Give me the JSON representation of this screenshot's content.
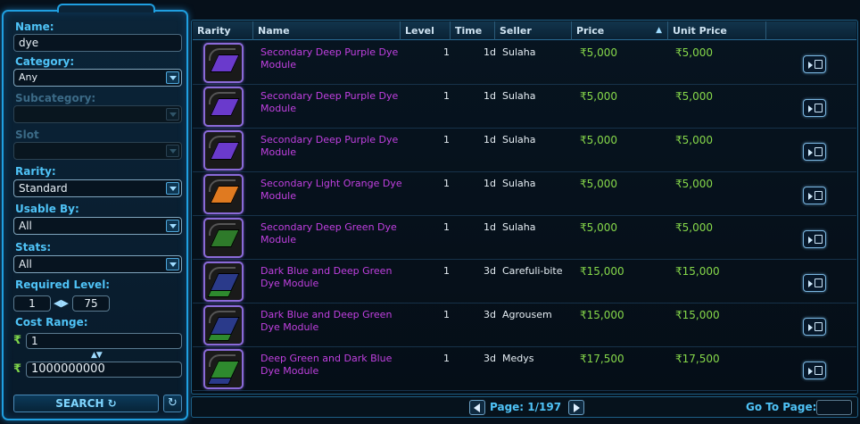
{
  "filters": {
    "name_label": "Name:",
    "name_value": "dye",
    "category_label": "Category:",
    "category_value": "Any",
    "subcategory_label": "Subcategory:",
    "subcategory_value": "",
    "slot_label": "Slot",
    "slot_value": "",
    "rarity_label": "Rarity:",
    "rarity_value": "Standard",
    "usable_label": "Usable By:",
    "usable_value": "All",
    "stats_label": "Stats:",
    "stats_value": "All",
    "level_label": "Required Level:",
    "level_min": "1",
    "level_max": "75",
    "cost_label": "Cost Range:",
    "cost_min": "1",
    "cost_max": "1000000000",
    "credit_symbol": "₹",
    "search_label": "SEARCH ↻",
    "reset_icon": "↻"
  },
  "table": {
    "headers": {
      "rarity": "Rarity",
      "name": "Name",
      "level": "Level",
      "time": "Time",
      "seller": "Seller",
      "price": "Price",
      "unit_price": "Unit Price"
    },
    "sort_indicator": "▲",
    "rows": [
      {
        "name": "Secondary Deep Purple Dye Module",
        "level": "1",
        "time": "1d",
        "seller": "Sulaha",
        "price": "₹5,000",
        "unit": "₹5,000",
        "colors": [
          "#6a3acc"
        ]
      },
      {
        "name": "Secondary Deep Purple Dye Module",
        "level": "1",
        "time": "1d",
        "seller": "Sulaha",
        "price": "₹5,000",
        "unit": "₹5,000",
        "colors": [
          "#6a3acc"
        ]
      },
      {
        "name": "Secondary Deep Purple Dye Module",
        "level": "1",
        "time": "1d",
        "seller": "Sulaha",
        "price": "₹5,000",
        "unit": "₹5,000",
        "colors": [
          "#6a3acc"
        ]
      },
      {
        "name": "Secondary Light Orange Dye Module",
        "level": "1",
        "time": "1d",
        "seller": "Sulaha",
        "price": "₹5,000",
        "unit": "₹5,000",
        "colors": [
          "#e07a20"
        ]
      },
      {
        "name": "Secondary Deep Green Dye Module",
        "level": "1",
        "time": "1d",
        "seller": "Sulaha",
        "price": "₹5,000",
        "unit": "₹5,000",
        "colors": [
          "#2e7a2a"
        ]
      },
      {
        "name": "Dark Blue and Deep Green Dye Module",
        "level": "1",
        "time": "3d",
        "seller": "Carefuli-bite",
        "price": "₹15,000",
        "unit": "₹15,000",
        "colors": [
          "#2a3a8a",
          "#2e8a2e"
        ]
      },
      {
        "name": "Dark Blue and Deep Green Dye Module",
        "level": "1",
        "time": "3d",
        "seller": "Agrousem",
        "price": "₹15,000",
        "unit": "₹15,000",
        "colors": [
          "#2a3a8a",
          "#2e8a2e"
        ]
      },
      {
        "name": "Deep Green and Dark Blue Dye Module",
        "level": "1",
        "time": "3d",
        "seller": "Medys",
        "price": "₹17,500",
        "unit": "₹17,500",
        "colors": [
          "#2e8a2e",
          "#2a3a8a"
        ]
      }
    ]
  },
  "pager": {
    "page_text": "Page: 1/197",
    "goto_label": "Go To Page:",
    "goto_value": ""
  },
  "colors": {
    "accent": "#1f9fe0",
    "label": "#4fc3f7",
    "item_name": "#c040e0",
    "price": "#86d84a"
  }
}
